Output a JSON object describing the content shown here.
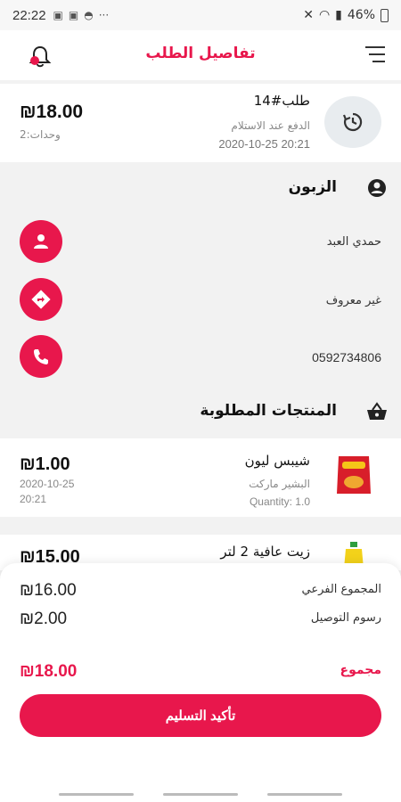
{
  "status_bar": {
    "time": "22:22",
    "battery": "46%"
  },
  "app_bar": {
    "title": "تفاصيل الطلب",
    "notification_badge": "0"
  },
  "order": {
    "number": "طلب#14",
    "payment": "الدفع عند الاستلام",
    "datetime": "2020-10-25 20:21",
    "total": "₪18.00",
    "units": "وحدات:2"
  },
  "customer": {
    "title": "الزبون",
    "name": "حمدي العبد",
    "address": "غير معروف",
    "phone": "0592734806"
  },
  "products": {
    "title": "المنتجات المطلوبة",
    "items": [
      {
        "name": "شيبس ليون",
        "store": "البشير ماركت",
        "quantity": "Quantity: 1.0",
        "price": "₪1.00",
        "date": "2020-10-25",
        "time": "20:21"
      },
      {
        "name": "زيت عافية 2 لتر",
        "price": "₪15.00"
      }
    ]
  },
  "summary": {
    "subtotal_label": "المجموع الفرعي",
    "subtotal": "₪16.00",
    "delivery_label": "رسوم التوصيل",
    "delivery": "₪2.00",
    "total_label": "مجموع",
    "total": "₪18.00",
    "confirm_label": "تأكيد التسليم"
  },
  "colors": {
    "accent": "#e8174c"
  }
}
